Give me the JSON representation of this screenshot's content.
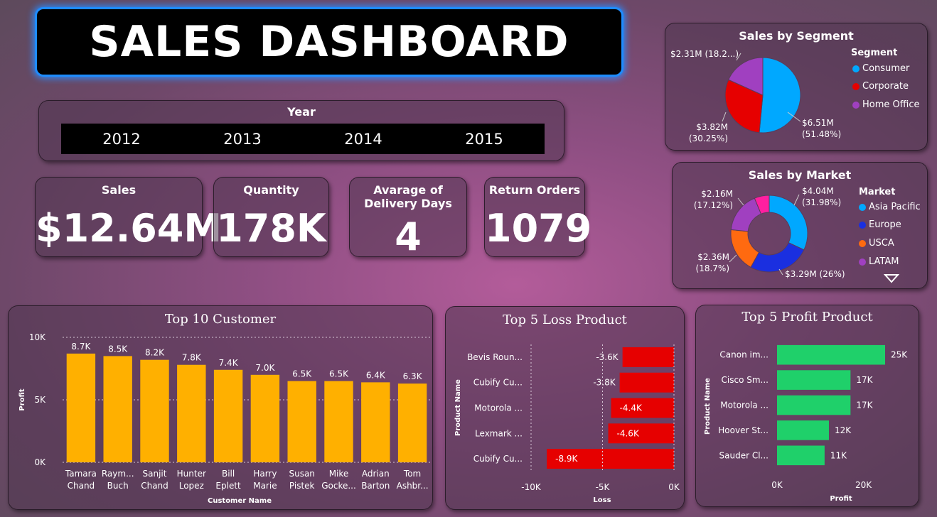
{
  "title": "SALES DASHBOARD",
  "year_slicer": {
    "label": "Year",
    "years": [
      "2012",
      "2013",
      "2014",
      "2015"
    ]
  },
  "kpis": {
    "sales": {
      "label": "Sales",
      "value": "$12.64M"
    },
    "quantity": {
      "label": "Quantity",
      "value": "178K"
    },
    "delivery": {
      "label": "Avarage of Delivery Days",
      "value": "4"
    },
    "returns": {
      "label": "Return Orders",
      "value": "1079"
    }
  },
  "colors": {
    "consumer": "#00a8ff",
    "corporate": "#e60000",
    "home_office": "#a040c0",
    "asia_pacific": "#00a8ff",
    "europe": "#1a2fe0",
    "usca": "#ff6a10",
    "latam": "#a040c0",
    "fifth_market": "#ff1fa0",
    "bar_yellow": "#ffb000",
    "bar_red": "#e60000",
    "bar_green": "#1fd06a"
  },
  "chart_data": [
    {
      "id": "segment",
      "type": "pie",
      "title": "Sales by Segment",
      "legend_title": "Segment",
      "legend_position": "right",
      "categories": [
        "Consumer",
        "Corporate",
        "Home Office"
      ],
      "values": [
        6.51,
        3.82,
        2.31
      ],
      "labels": [
        [
          "$6.51M",
          "(51.48%)"
        ],
        [
          "$3.82M",
          "(30.25%)"
        ],
        [
          "$2.31M (18.2...)"
        ]
      ]
    },
    {
      "id": "market",
      "type": "pie",
      "title": "Sales by Market",
      "legend_title": "Market",
      "legend_position": "right",
      "categories": [
        "Asia Pacific",
        "Europe",
        "USCA",
        "LATAM"
      ],
      "values": [
        4.04,
        3.29,
        2.36,
        2.16,
        0.79
      ],
      "labels": [
        [
          "$4.04M",
          "(31.98%)"
        ],
        [
          "$3.29M (26%)"
        ],
        [
          "$2.36M",
          "(18.7%)"
        ],
        [
          "$2.16M",
          "(17.12%)"
        ]
      ]
    },
    {
      "id": "customers",
      "type": "bar",
      "title": "Top 10 Customer",
      "xlabel": "Customer Name",
      "ylabel": "Profit",
      "ylim": [
        0,
        10000
      ],
      "yticks": [
        "0K",
        "5K",
        "10K"
      ],
      "categories": [
        [
          "Tamara",
          "Chand"
        ],
        [
          "Raym...",
          "Buch"
        ],
        [
          "Sanjit",
          "Chand"
        ],
        [
          "Hunter",
          "Lopez"
        ],
        [
          "Bill",
          "Eplett"
        ],
        [
          "Harry",
          "Marie"
        ],
        [
          "Susan",
          "Pistek"
        ],
        [
          "Mike",
          "Gocke..."
        ],
        [
          "Adrian",
          "Barton"
        ],
        [
          "Tom",
          "Ashbr..."
        ]
      ],
      "values": [
        8700,
        8500,
        8200,
        7800,
        7400,
        7000,
        6500,
        6500,
        6400,
        6300
      ],
      "data_labels": [
        "8.7K",
        "8.5K",
        "8.2K",
        "7.8K",
        "7.4K",
        "7.0K",
        "6.5K",
        "6.5K",
        "6.4K",
        "6.3K"
      ]
    },
    {
      "id": "loss",
      "type": "bar",
      "title": "Top 5 Loss Product",
      "xlabel": "Loss",
      "ylabel": "Product Name",
      "xlim": [
        -10000,
        0
      ],
      "xticks": [
        "-10K",
        "-5K",
        "0K"
      ],
      "categories": [
        "Bevis Roun...",
        "Cubify Cu...",
        "Motorola ...",
        "Lexmark ...",
        "Cubify Cu..."
      ],
      "values": [
        -3600,
        -3800,
        -4400,
        -4600,
        -8900
      ],
      "data_labels": [
        "-3.6K",
        "-3.8K",
        "-4.4K",
        "-4.6K",
        "-8.9K"
      ]
    },
    {
      "id": "profit",
      "type": "bar",
      "title": "Top 5 Profit Product",
      "xlabel": "Profit",
      "ylabel": "Product Name",
      "xlim": [
        0,
        25000
      ],
      "xticks": [
        "0K",
        "20K"
      ],
      "categories": [
        "Canon im...",
        "Cisco Sm...",
        "Motorola ...",
        "Hoover St...",
        "Sauder Cl..."
      ],
      "values": [
        25000,
        17000,
        17000,
        12000,
        11000
      ],
      "data_labels": [
        "25K",
        "17K",
        "17K",
        "12K",
        "11K"
      ]
    }
  ]
}
